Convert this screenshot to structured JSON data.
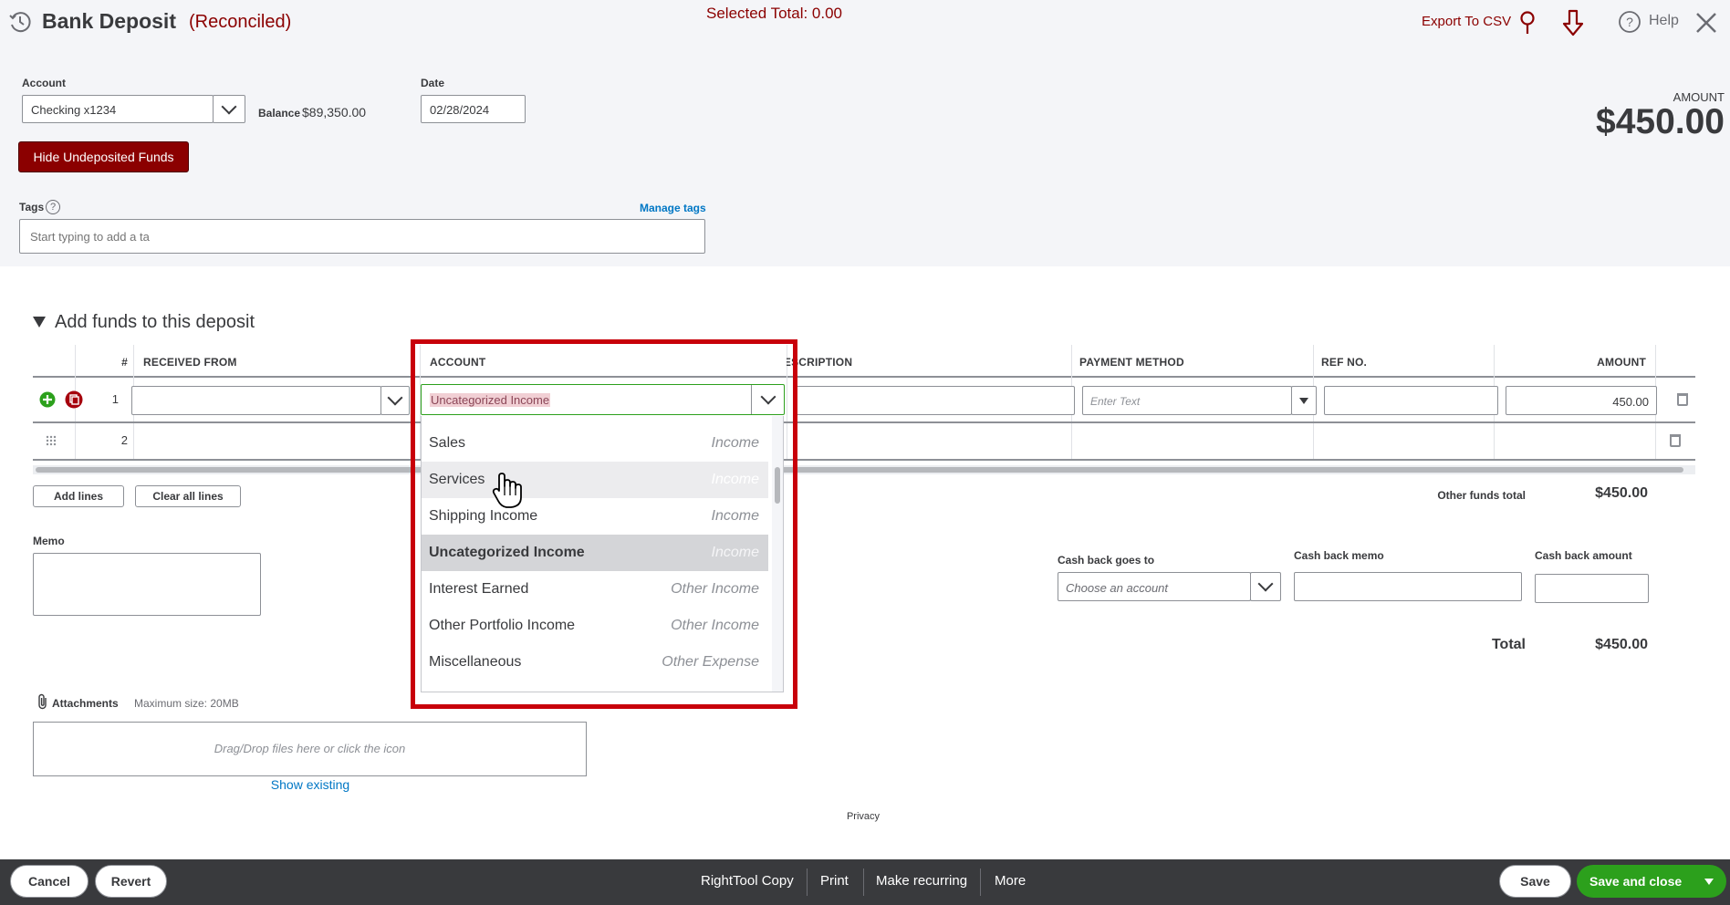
{
  "header": {
    "title": "Bank Deposit",
    "status": "(Reconciled)",
    "selected_total": "Selected Total: 0.00",
    "export": "Export To CSV",
    "help": "Help"
  },
  "form": {
    "account_label": "Account",
    "account_value": "Checking x1234",
    "balance_label": "Balance",
    "balance_value": "$89,350.00",
    "date_label": "Date",
    "date_value": "02/28/2024",
    "amount_label": "AMOUNT",
    "amount_value": "$450.00",
    "hide_button": "Hide Undeposited Funds",
    "tags_label": "Tags",
    "tags_help": "?",
    "manage_tags": "Manage tags",
    "tags_placeholder": "Start typing to add a ta"
  },
  "section": {
    "title": "Add funds to this deposit"
  },
  "table": {
    "headers": [
      "#",
      "RECEIVED FROM",
      "ACCOUNT",
      "DESCRIPTION",
      "PAYMENT METHOD",
      "REF NO.",
      "AMOUNT"
    ],
    "rows": [
      {
        "num": "1",
        "account": "Uncategorized Income",
        "payment_placeholder": "Enter Text",
        "amount": "450.00"
      },
      {
        "num": "2"
      }
    ]
  },
  "dropdown": {
    "items": [
      {
        "name": "Sales",
        "type": "Income"
      },
      {
        "name": "Services",
        "type": "Income"
      },
      {
        "name": "Shipping Income",
        "type": "Income"
      },
      {
        "name": "Uncategorized Income",
        "type": "Income"
      },
      {
        "name": "Interest Earned",
        "type": "Other Income"
      },
      {
        "name": "Other Portfolio Income",
        "type": "Other Income"
      },
      {
        "name": "Miscellaneous",
        "type": "Other Expense"
      }
    ],
    "highlight_color": "#c8000a"
  },
  "actions": {
    "add_lines": "Add lines",
    "clear_lines": "Clear all lines",
    "other_funds_label": "Other funds total",
    "other_funds_value": "$450.00"
  },
  "memo": {
    "label": "Memo"
  },
  "cashback": {
    "goes_to_label": "Cash back goes to",
    "goes_to_placeholder": "Choose an account",
    "memo_label": "Cash back memo",
    "amount_label": "Cash back amount"
  },
  "total": {
    "label": "Total",
    "value": "$450.00"
  },
  "attachments": {
    "label": "Attachments",
    "max_size": "Maximum size: 20MB",
    "drop_text": "Drag/Drop files here or click the icon",
    "show_existing": "Show existing"
  },
  "privacy": "Privacy",
  "footer": {
    "cancel": "Cancel",
    "revert": "Revert",
    "righttool": "RightTool Copy",
    "print": "Print",
    "recurring": "Make recurring",
    "more": "More",
    "save": "Save",
    "save_close": "Save and close"
  },
  "colors": {
    "brand_red": "#8b0000",
    "green": "#2ca01c",
    "footer_bg": "#393a3d",
    "link_blue": "#0077c5"
  }
}
